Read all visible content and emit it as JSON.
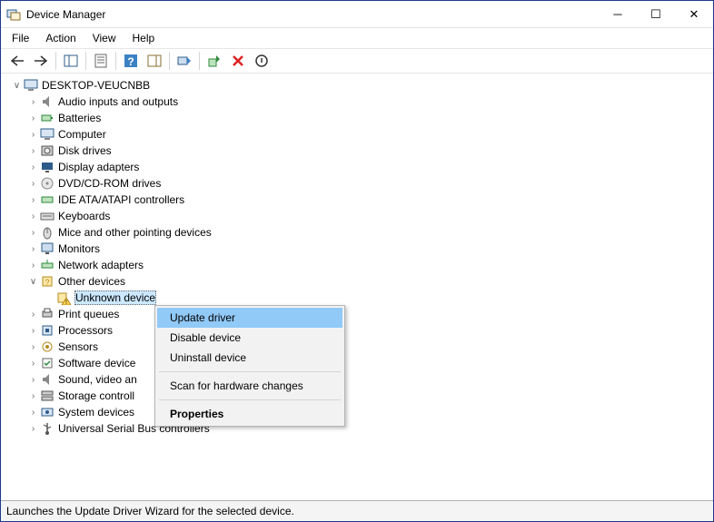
{
  "title": "Device Manager",
  "menu": {
    "file": "File",
    "action": "Action",
    "view": "View",
    "help": "Help"
  },
  "root_name": "DESKTOP-VEUCNBB",
  "categories": [
    {
      "icon": "audio",
      "label": "Audio inputs and outputs"
    },
    {
      "icon": "battery",
      "label": "Batteries"
    },
    {
      "icon": "computer",
      "label": "Computer"
    },
    {
      "icon": "disk",
      "label": "Disk drives"
    },
    {
      "icon": "display",
      "label": "Display adapters"
    },
    {
      "icon": "dvd",
      "label": "DVD/CD-ROM drives"
    },
    {
      "icon": "ide",
      "label": "IDE ATA/ATAPI controllers"
    },
    {
      "icon": "keyboard",
      "label": "Keyboards"
    },
    {
      "icon": "mouse",
      "label": "Mice and other pointing devices"
    },
    {
      "icon": "monitor",
      "label": "Monitors"
    },
    {
      "icon": "network",
      "label": "Network adapters"
    }
  ],
  "other_devices_label": "Other devices",
  "unknown_device_label": "Unknown device",
  "after_categories": [
    {
      "icon": "printer",
      "label": "Print queues"
    },
    {
      "icon": "cpu",
      "label": "Processors"
    },
    {
      "icon": "sensor",
      "label": "Sensors"
    },
    {
      "icon": "software",
      "label": "Software device"
    },
    {
      "icon": "audio",
      "label": "Sound, video an"
    },
    {
      "icon": "storage",
      "label": "Storage controll"
    },
    {
      "icon": "system",
      "label": "System devices"
    },
    {
      "icon": "usb",
      "label": "Universal Serial Bus controllers"
    }
  ],
  "context": {
    "update": "Update driver",
    "disable": "Disable device",
    "uninstall": "Uninstall device",
    "scan": "Scan for hardware changes",
    "properties": "Properties"
  },
  "status": "Launches the Update Driver Wizard for the selected device."
}
